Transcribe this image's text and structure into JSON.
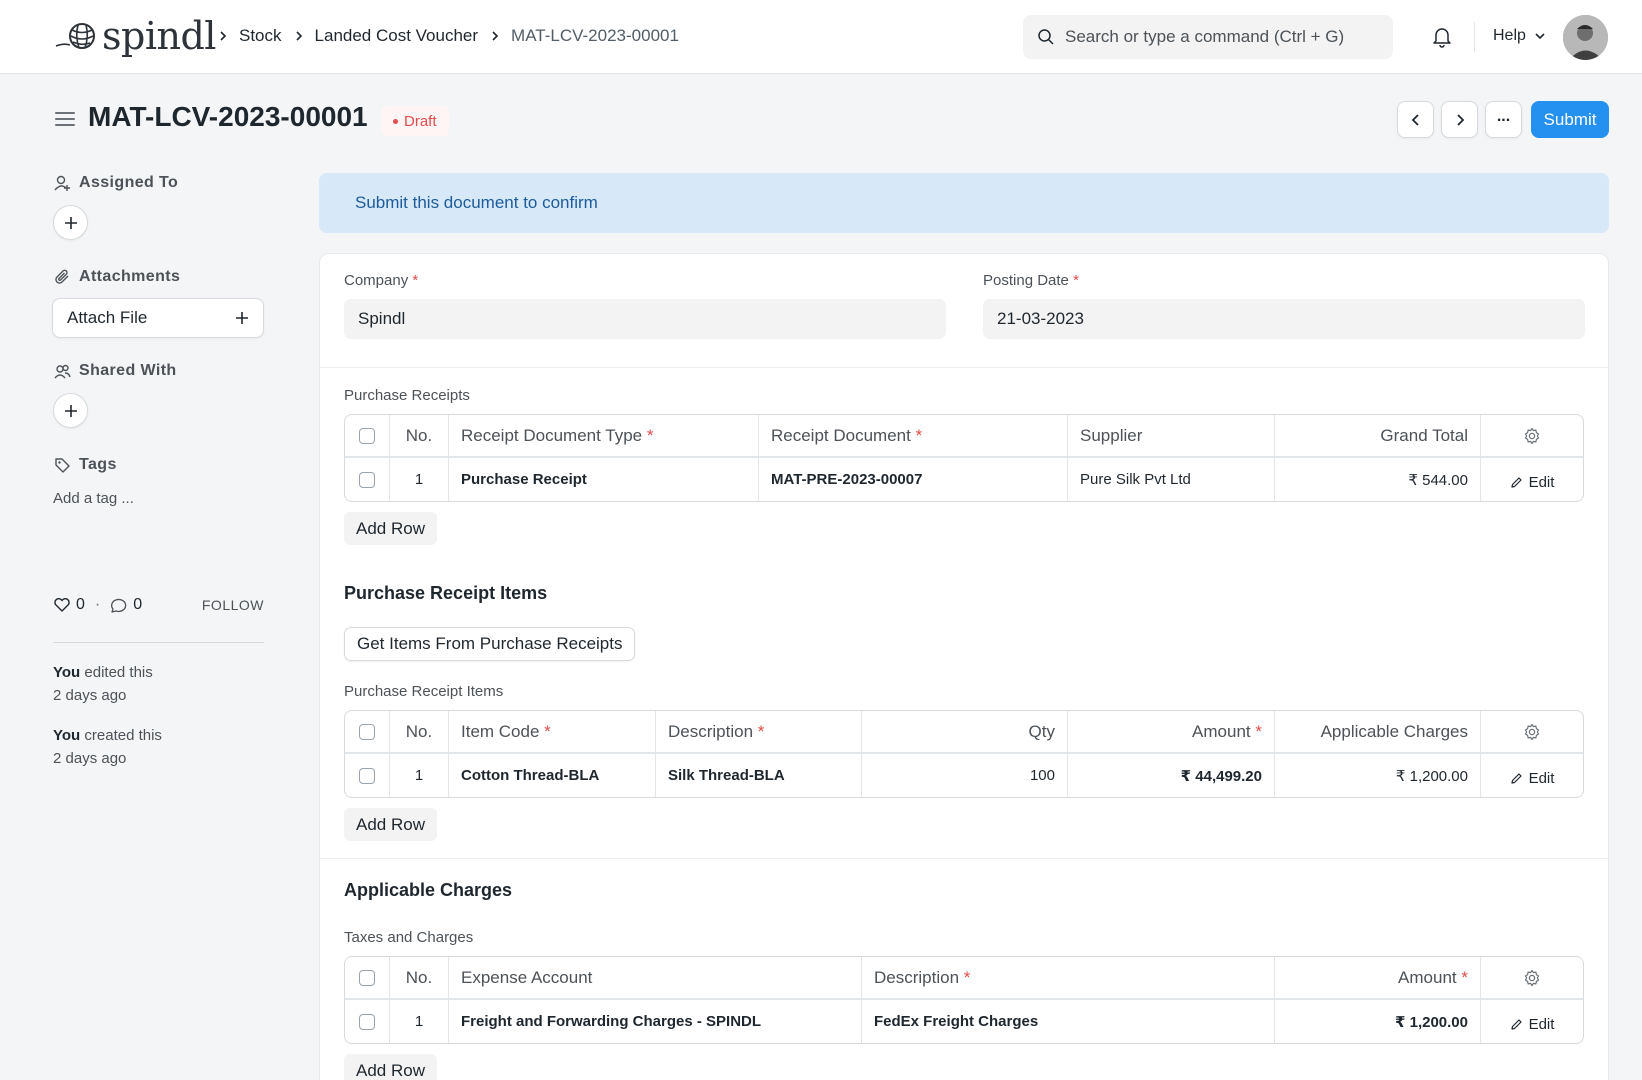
{
  "app": {
    "logo_text": "spindl"
  },
  "breadcrumbs": [
    "Stock",
    "Landed Cost Voucher",
    "MAT-LCV-2023-00001"
  ],
  "search": {
    "placeholder": "Search or type a command (Ctrl + G)"
  },
  "nav": {
    "help_label": "Help"
  },
  "header": {
    "title": "MAT-LCV-2023-00001",
    "status": "Draft",
    "more_label": "...",
    "submit_label": "Submit"
  },
  "colors": {
    "primary": "#2490ef",
    "danger": "#e24c4c",
    "alert_bg": "#d7e8f9",
    "alert_text": "#1d5b9a"
  },
  "sidebar": {
    "assigned_to": "Assigned To",
    "attachments": "Attachments",
    "attach_file": "Attach File",
    "shared_with": "Shared With",
    "tags": "Tags",
    "add_tag": "Add a tag ...",
    "likes": "0",
    "comments": "0",
    "follow": "FOLLOW",
    "activity": [
      {
        "user": "You",
        "action": " edited this",
        "time": "2 days ago"
      },
      {
        "user": "You",
        "action": " created this",
        "time": "2 days ago"
      }
    ]
  },
  "alert": "Submit this document to confirm",
  "form": {
    "company": {
      "label": "Company",
      "value": "Spindl"
    },
    "posting_date": {
      "label": "Posting Date",
      "value": "21-03-2023"
    },
    "add_row": "Add Row",
    "edit": "Edit",
    "purchase_receipts": {
      "label": "Purchase Receipts",
      "headers": [
        "No.",
        "Receipt Document Type",
        "Receipt Document",
        "Supplier",
        "Grand Total"
      ],
      "rows": [
        {
          "no": "1",
          "type": "Purchase Receipt",
          "document": "MAT-PRE-2023-00007",
          "supplier": "Pure Silk Pvt Ltd",
          "grand_total": "₹ 544.00"
        }
      ]
    },
    "items_section": {
      "title": "Purchase Receipt Items",
      "get_items_label": "Get Items From Purchase Receipts",
      "table_label": "Purchase Receipt Items",
      "headers": [
        "No.",
        "Item Code",
        "Description",
        "Qty",
        "Amount",
        "Applicable Charges"
      ],
      "rows": [
        {
          "no": "1",
          "item_code": "Cotton Thread-BLA",
          "description": "Silk Thread-BLA",
          "qty": "100",
          "amount": "₹ 44,499.20",
          "charges": "₹ 1,200.00"
        }
      ]
    },
    "charges_section": {
      "title": "Applicable Charges",
      "table_label": "Taxes and Charges",
      "headers": [
        "No.",
        "Expense Account",
        "Description",
        "Amount"
      ],
      "rows": [
        {
          "no": "1",
          "account": "Freight and Forwarding Charges - SPINDL",
          "description": "FedEx Freight Charges",
          "amount": "₹ 1,200.00"
        }
      ]
    }
  }
}
